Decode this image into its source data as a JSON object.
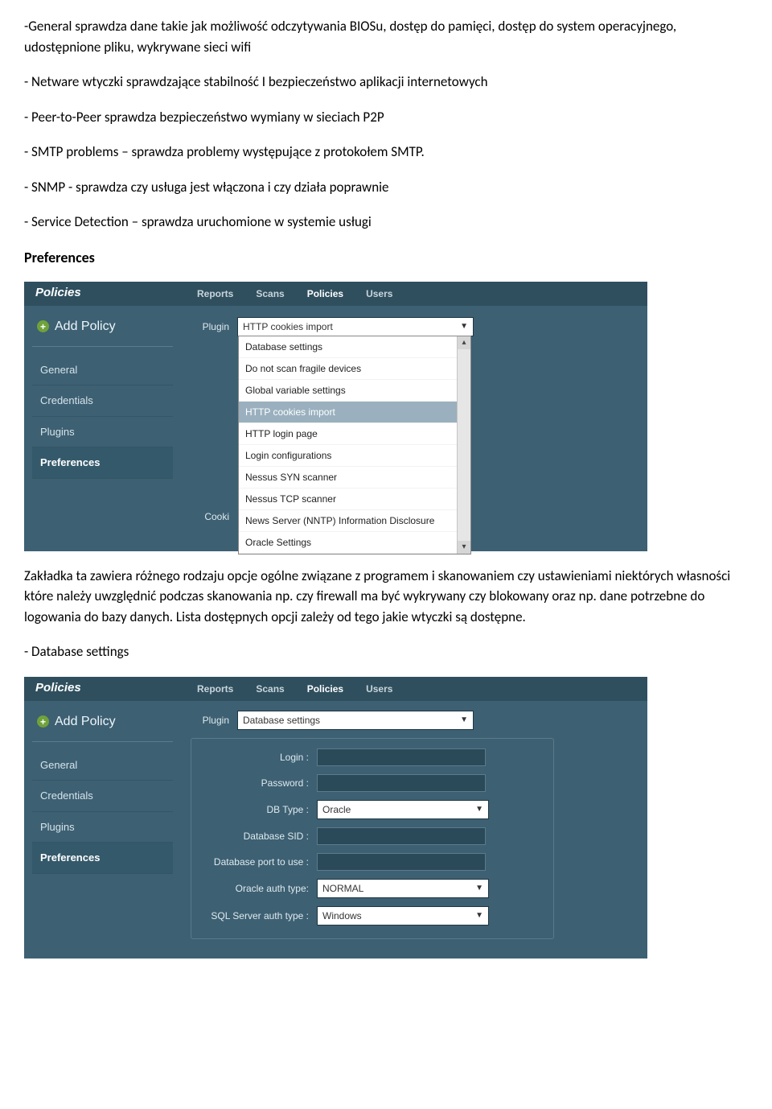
{
  "text": {
    "p1": "-General sprawdza dane takie jak możliwość odczytywania BIOSu, dostęp do pamięci, dostęp do system operacyjnego, udostępnione pliku, wykrywane sieci wifi",
    "p2": "- Netware wtyczki sprawdzające stabilność I bezpieczeństwo aplikacji internetowych",
    "p3": "- Peer-to-Peer sprawdza bezpieczeństwo wymiany w sieciach P2P",
    "p4": "- SMTP problems – sprawdza problemy występujące z protokołem SMTP.",
    "p5": "- SNMP - sprawdza czy usługa jest włączona i czy działa poprawnie",
    "p6": "- Service Detection – sprawdza uruchomione w systemie usługi",
    "prefs_heading": "Preferences",
    "p7": "Zakładka ta zawiera różnego rodzaju opcje ogólne związane z programem i skanowaniem czy ustawieniami niektórych własności które należy uwzględnić podczas skanowania np. czy firewall ma być wykrywany czy blokowany oraz np. dane potrzebne do logowania do bazy danych. Lista dostępnych opcji zależy od tego jakie wtyczki są dostępne.",
    "p8": "- Database settings"
  },
  "ui": {
    "section_title": "Policies",
    "tabs": {
      "reports": "Reports",
      "scans": "Scans",
      "policies": "Policies",
      "users": "Users"
    },
    "add_policy": "Add Policy",
    "side": {
      "general": "General",
      "credentials": "Credentials",
      "plugins": "Plugins",
      "preferences": "Preferences"
    },
    "labels": {
      "plugin": "Plugin",
      "cookie": "Cooki",
      "login": "Login :",
      "password": "Password :",
      "dbtype": "DB Type :",
      "sid": "Database SID :",
      "port": "Database port to use :",
      "oracle_auth": "Oracle auth type:",
      "sql_auth": "SQL Server auth type :"
    },
    "plugin_value_1": "HTTP cookies import",
    "plugin_value_2": "Database settings",
    "dbtype_value": "Oracle",
    "oracle_auth_value": "NORMAL",
    "sql_auth_value": "Windows",
    "dropdown": {
      "items": [
        "Database settings",
        "Do not scan fragile devices",
        "Global variable settings",
        "HTTP cookies import",
        "HTTP login page",
        "Login configurations",
        "Nessus SYN scanner",
        "Nessus TCP scanner",
        "News Server (NNTP) Information Disclosure",
        "Oracle Settings"
      ]
    }
  }
}
